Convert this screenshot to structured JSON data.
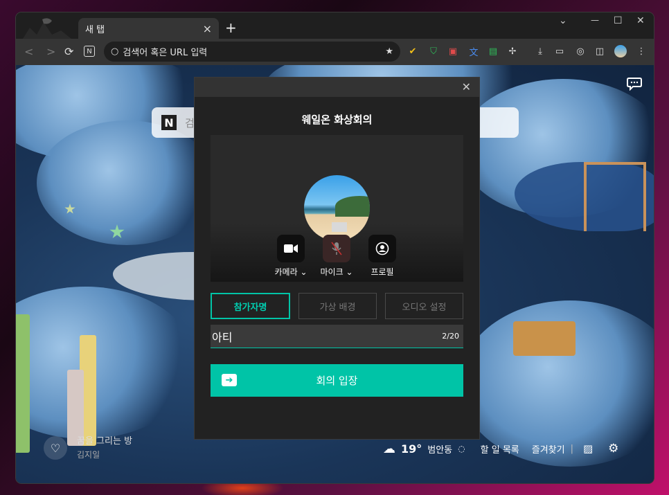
{
  "browser": {
    "tab_title": "새 탭",
    "tab_close": "×",
    "new_tab": "+",
    "address_placeholder": "검색어 혹은 URL 입력",
    "window_controls": {
      "dropdown": "⌄",
      "minimize": "—",
      "maximize": "☐",
      "close": "✕"
    }
  },
  "newtab_page": {
    "search_placeholder": "검",
    "artwork_title": "꿈을 그리는 방",
    "artwork_author": "김지일",
    "weather_temp": "19°",
    "weather_location": "범안동",
    "todo_label": "할 일 목록",
    "bookmarks_label": "즐겨찾기",
    "separator": "|"
  },
  "modal": {
    "close": "✕",
    "title": "웨일온 화상회의",
    "controls": {
      "camera_label": "카메라",
      "mic_label": "마이크",
      "profile_label": "프로필"
    },
    "tabs": [
      "참가자명",
      "가상 배경",
      "오디오 설정"
    ],
    "name_value": "아티",
    "name_count": "2/20",
    "enter_button": "회의 입장"
  },
  "colors": {
    "accent": "#00c4a7",
    "modal_bg": "#222222"
  },
  "icons": [
    "back-icon",
    "forward-icon",
    "reload-icon",
    "naver-icon",
    "search-icon",
    "star-icon",
    "camera-icon",
    "mic-muted-icon",
    "profile-icon",
    "chat-icon",
    "heart-icon",
    "weather-icon",
    "image-icon",
    "gear-icon",
    "enter-icon"
  ]
}
